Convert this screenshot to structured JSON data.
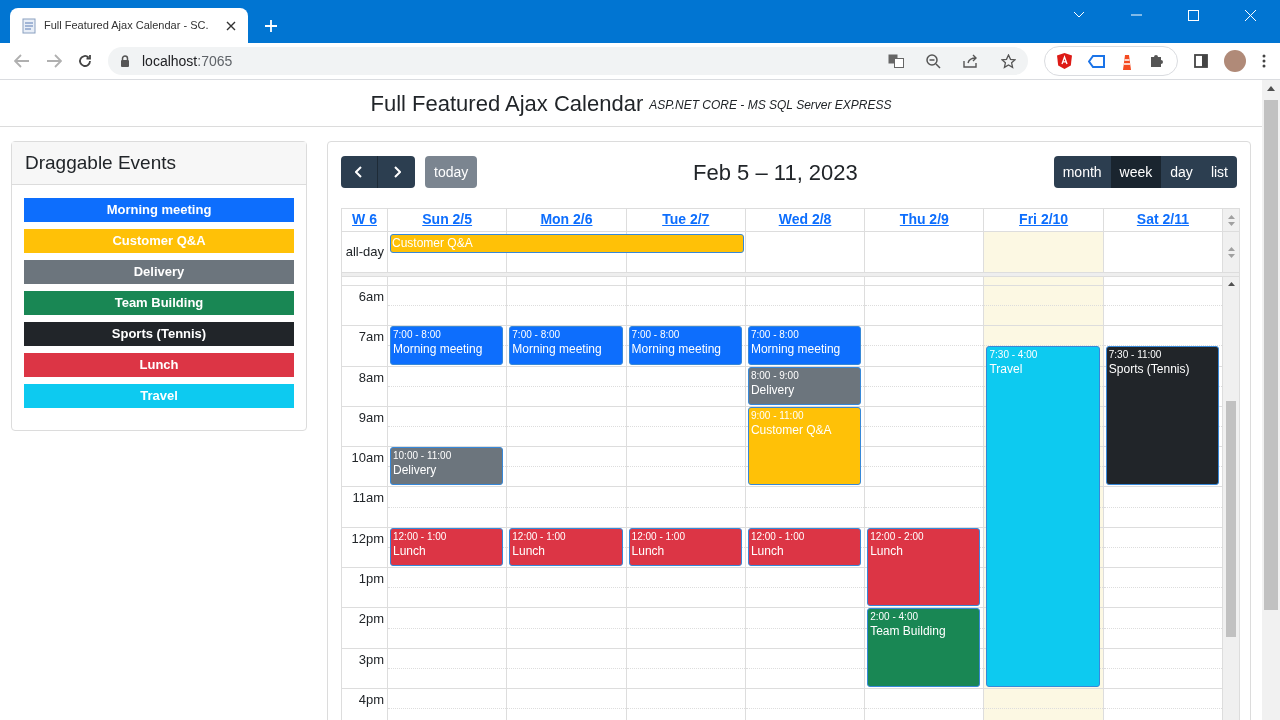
{
  "browser": {
    "tab_title": "Full Featured Ajax Calendar - SC.",
    "url_host": "localhost",
    "url_port": ":7065"
  },
  "header": {
    "title": "Full Featured Ajax Calendar",
    "subtitle": "ASP.NET CORE - MS SQL Server EXPRESS"
  },
  "sidebar": {
    "title": "Draggable Events",
    "events": [
      {
        "label": "Morning meeting",
        "color": "#0d6efd"
      },
      {
        "label": "Customer Q&A",
        "color": "#ffc107"
      },
      {
        "label": "Delivery",
        "color": "#6c757d"
      },
      {
        "label": "Team Building",
        "color": "#198754"
      },
      {
        "label": "Sports (Tennis)",
        "color": "#212529"
      },
      {
        "label": "Lunch",
        "color": "#dc3545"
      },
      {
        "label": "Travel",
        "color": "#0dcaf0"
      }
    ]
  },
  "calendar": {
    "title": "Feb 5 – 11, 2023",
    "today_button": {
      "label": "today",
      "disabled": true
    },
    "views": [
      {
        "label": "month",
        "selected": false
      },
      {
        "label": "week",
        "selected": true
      },
      {
        "label": "day",
        "selected": false
      },
      {
        "label": "list",
        "selected": false
      }
    ],
    "week_label": "W 6",
    "all_day_label": "all-day",
    "days": [
      {
        "heading": "Sun 2/5",
        "today": false,
        "all_day_covered": true,
        "events": [
          {
            "time": "7:00 - 8:00",
            "title": "Morning meeting",
            "color": "#0d6efd"
          },
          {
            "time": "10:00 - 11:00",
            "title": "Delivery",
            "color": "#6c757d"
          },
          {
            "time": "12:00 - 1:00",
            "title": "Lunch",
            "color": "#dc3545"
          }
        ]
      },
      {
        "heading": "Mon 2/6",
        "today": false,
        "all_day_covered": true,
        "events": [
          {
            "time": "7:00 - 8:00",
            "title": "Morning meeting",
            "color": "#0d6efd"
          },
          {
            "time": "12:00 - 1:00",
            "title": "Lunch",
            "color": "#dc3545"
          }
        ]
      },
      {
        "heading": "Tue 2/7",
        "today": false,
        "all_day_covered": true,
        "events": [
          {
            "time": "7:00 - 8:00",
            "title": "Morning meeting",
            "color": "#0d6efd"
          },
          {
            "time": "12:00 - 1:00",
            "title": "Lunch",
            "color": "#dc3545"
          }
        ]
      },
      {
        "heading": "Wed 2/8",
        "today": false,
        "all_day_covered": false,
        "events": [
          {
            "time": "7:00 - 8:00",
            "title": "Morning meeting",
            "color": "#0d6efd"
          },
          {
            "time": "8:00 - 9:00",
            "title": "Delivery",
            "color": "#6c757d"
          },
          {
            "time": "9:00 - 11:00",
            "title": "Customer Q&A",
            "color": "#ffc107"
          },
          {
            "time": "12:00 - 1:00",
            "title": "Lunch",
            "color": "#dc3545"
          }
        ]
      },
      {
        "heading": "Thu 2/9",
        "today": false,
        "all_day_covered": false,
        "events": [
          {
            "time": "12:00 - 2:00",
            "title": "Lunch",
            "color": "#dc3545"
          },
          {
            "time": "2:00 - 4:00",
            "title": "Team Building",
            "color": "#198754"
          }
        ]
      },
      {
        "heading": "Fri 2/10",
        "today": true,
        "all_day_covered": false,
        "events": [
          {
            "time": "7:30 - 4:00",
            "title": "Travel",
            "color": "#0dcaf0"
          }
        ]
      },
      {
        "heading": "Sat 2/11",
        "today": false,
        "all_day_covered": false,
        "events": [
          {
            "time": "7:30 - 11:00",
            "title": "Sports (Tennis)",
            "color": "#212529"
          }
        ]
      }
    ],
    "all_day_events": [
      {
        "title": "Customer Q&A",
        "color": "#ffc107"
      }
    ],
    "hours": [
      "6am",
      "7am",
      "8am",
      "9am",
      "10am",
      "11am",
      "12pm",
      "1pm",
      "2pm",
      "3pm",
      "4pm"
    ]
  }
}
